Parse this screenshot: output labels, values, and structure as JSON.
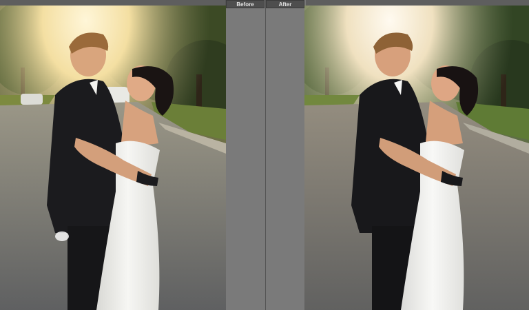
{
  "labels": {
    "before": "Before",
    "after": "After"
  },
  "panes": [
    {
      "name": "before-photo",
      "tone": "warm-original"
    },
    {
      "name": "after-photo",
      "tone": "edited"
    }
  ],
  "colors": {
    "panel": "#7b7b7b",
    "label_bg": "#4e4e4e",
    "label_text": "#e6e6e6",
    "suit": "#1a1a1d",
    "dress": "#f2f2f0",
    "road": "#6d6f70",
    "grass": "#5f7b35",
    "sun": "#fff3c9"
  }
}
